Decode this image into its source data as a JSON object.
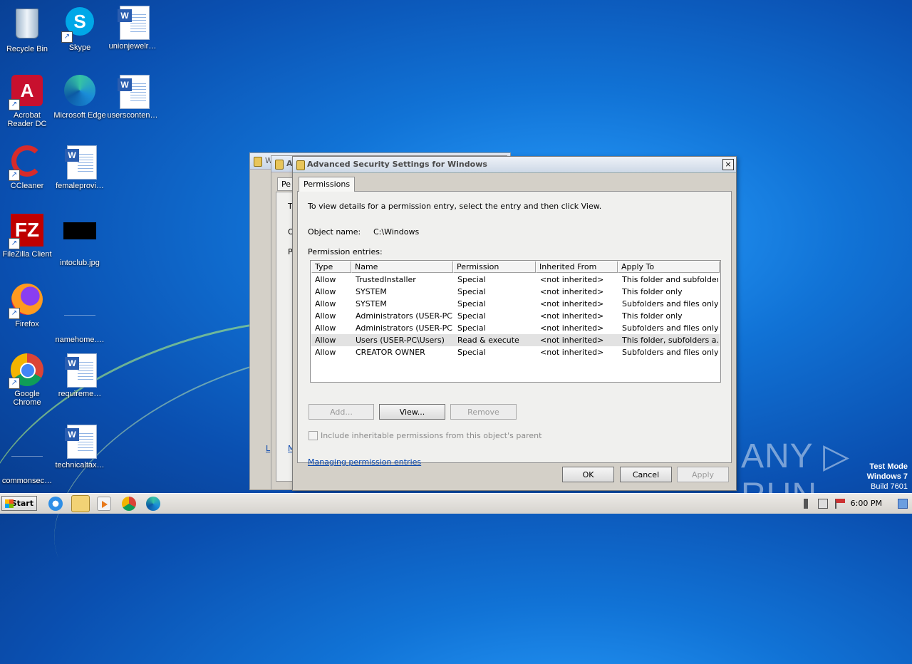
{
  "desktop": {
    "icons": [
      {
        "label": "Recycle Bin",
        "icon": "recycle-bin-icon"
      },
      {
        "label": "Skype",
        "icon": "skype-icon"
      },
      {
        "label": "unionjewelr…",
        "icon": "word-doc-icon"
      },
      {
        "label": "Acrobat Reader DC",
        "icon": "acrobat-icon"
      },
      {
        "label": "Microsoft Edge",
        "icon": "edge-icon"
      },
      {
        "label": "usersconten…",
        "icon": "word-doc-icon"
      },
      {
        "label": "CCleaner",
        "icon": "ccleaner-icon"
      },
      {
        "label": "femaleprovi…",
        "icon": "word-doc-icon"
      },
      {
        "label": "FileZilla Client",
        "icon": "filezilla-icon"
      },
      {
        "label": "intoclub.jpg",
        "icon": "image-file-icon"
      },
      {
        "label": "Firefox",
        "icon": "firefox-icon"
      },
      {
        "label": "namehome.…",
        "icon": "blank-file-icon"
      },
      {
        "label": "Google Chrome",
        "icon": "chrome-icon"
      },
      {
        "label": "requireme…",
        "icon": "word-doc-icon"
      },
      {
        "label": "commonsec…",
        "icon": "blank-file-icon"
      },
      {
        "label": "technicaltax…",
        "icon": "word-doc-icon"
      }
    ]
  },
  "background_windows": {
    "win1_title": "W",
    "win2_title": "A",
    "win2_tab": "Pe",
    "fragments": [
      "T",
      "O",
      "P",
      "L",
      "M"
    ]
  },
  "dialog": {
    "title": "Advanced Security Settings for Windows",
    "close": "×",
    "tab": "Permissions",
    "instruction": "To view details for a permission entry, select the entry and then click View.",
    "object_name_label": "Object name:",
    "object_name_value": "C:\\Windows",
    "entries_label": "Permission entries:",
    "columns": [
      "Type",
      "Name",
      "Permission",
      "Inherited From",
      "Apply To"
    ],
    "rows": [
      [
        "Allow",
        "TrustedInstaller",
        "Special",
        "<not inherited>",
        "This folder and subfolders"
      ],
      [
        "Allow",
        "SYSTEM",
        "Special",
        "<not inherited>",
        "This folder only"
      ],
      [
        "Allow",
        "SYSTEM",
        "Special",
        "<not inherited>",
        "Subfolders and files only"
      ],
      [
        "Allow",
        "Administrators (USER-PC…",
        "Special",
        "<not inherited>",
        "This folder only"
      ],
      [
        "Allow",
        "Administrators (USER-PC…",
        "Special",
        "<not inherited>",
        "Subfolders and files only"
      ],
      [
        "Allow",
        "Users (USER-PC\\Users)",
        "Read & execute",
        "<not inherited>",
        "This folder, subfolders a…"
      ],
      [
        "Allow",
        "CREATOR OWNER",
        "Special",
        "<not inherited>",
        "Subfolders and files only"
      ]
    ],
    "selected_row": 5,
    "add_button": "Add...",
    "view_button": "View...",
    "remove_button": "Remove",
    "inherit_checkbox_label": "Include inheritable permissions from this object's parent",
    "inherit_checked": false,
    "manage_link": "Managing permission entries",
    "ok_button": "OK",
    "cancel_button": "Cancel",
    "apply_button": "Apply"
  },
  "watermark": {
    "text": "ANY ▷ RUN",
    "mode": "Test Mode",
    "os": "Windows 7",
    "build": "Build 7601"
  },
  "taskbar": {
    "start_label": "Start",
    "clock": "6:00 PM",
    "pinned": [
      "ie-icon",
      "explorer-icon",
      "media-player-icon",
      "chrome-icon",
      "edge-icon"
    ]
  }
}
